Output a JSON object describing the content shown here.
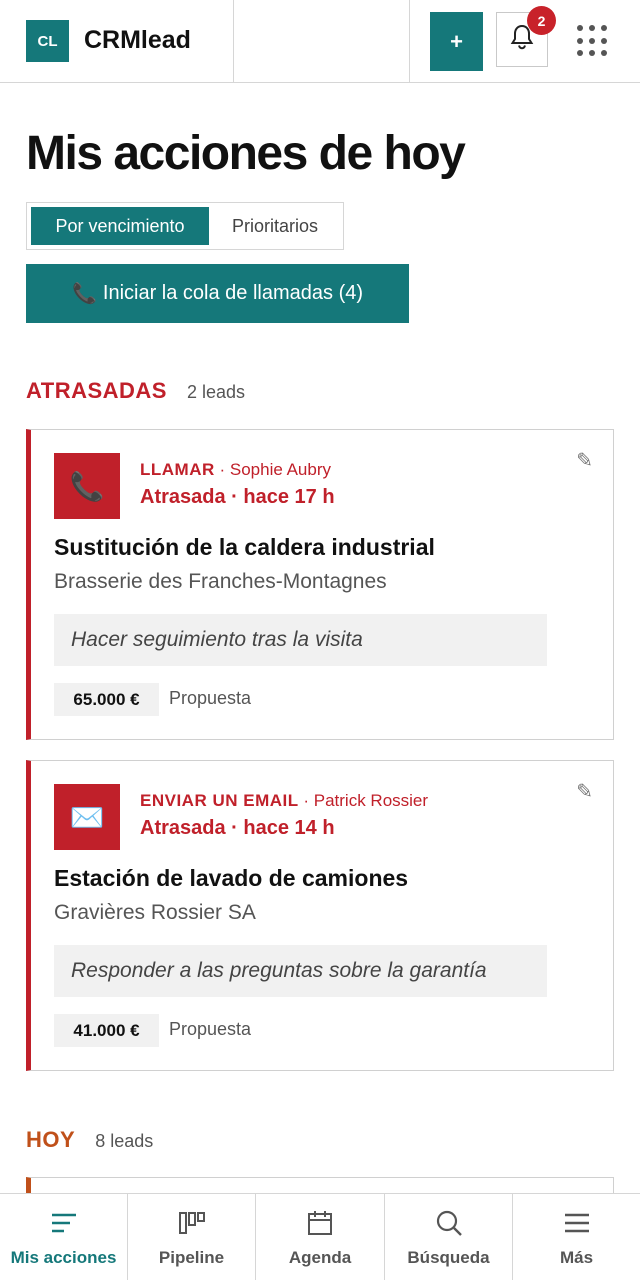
{
  "header": {
    "logo_initials": "CL",
    "brand": "CRMlead",
    "add_label": "+",
    "notifications_count": "2",
    "icons": [
      "bell-icon",
      "apps-grid-icon"
    ]
  },
  "page": {
    "title": "Mis acciones de hoy",
    "tabs": [
      {
        "label": "Por vencimiento",
        "active": true
      },
      {
        "label": "Prioritarios",
        "active": false
      }
    ],
    "call_queue_label": "Iniciar la cola de llamadas (4)"
  },
  "sections": {
    "late": {
      "label": "ATRASADAS",
      "count": "2 leads"
    },
    "today": {
      "label": "HOY",
      "count": "8 leads"
    }
  },
  "cards": [
    {
      "type_icon": "phone-icon",
      "type": "LLAMAR",
      "contact": "Sophie Aubry",
      "status": "Atrasada · hace 17 h",
      "deal": "Sustitución de la caldera industrial",
      "company": "Brasserie des Franches-Montagnes",
      "note": "Hacer seguimiento tras la visita",
      "amount": "65.000 €",
      "stage": "Propuesta"
    },
    {
      "type_icon": "envelope-icon",
      "type": "ENVIAR UN EMAIL",
      "contact": "Patrick Rossier",
      "status": "Atrasada · hace 14 h",
      "deal": "Estación de lavado de camiones",
      "company": "Gravières Rossier SA",
      "note": "Responder a las preguntas sobre la garantía",
      "amount": "41.000 €",
      "stage": "Propuesta"
    }
  ],
  "separator": " · ",
  "nav": [
    {
      "label": "Mis acciones",
      "icon": "list-icon",
      "active": true
    },
    {
      "label": "Pipeline",
      "icon": "kanban-icon",
      "active": false
    },
    {
      "label": "Agenda",
      "icon": "calendar-icon",
      "active": false
    },
    {
      "label": "Búsqueda",
      "icon": "search-icon",
      "active": false
    },
    {
      "label": "Más",
      "icon": "menu-icon",
      "active": false
    }
  ],
  "colors": {
    "accent": "#15787a",
    "overdue": "#c0202a",
    "today": "#c0501a",
    "badge": "#c8222a"
  }
}
